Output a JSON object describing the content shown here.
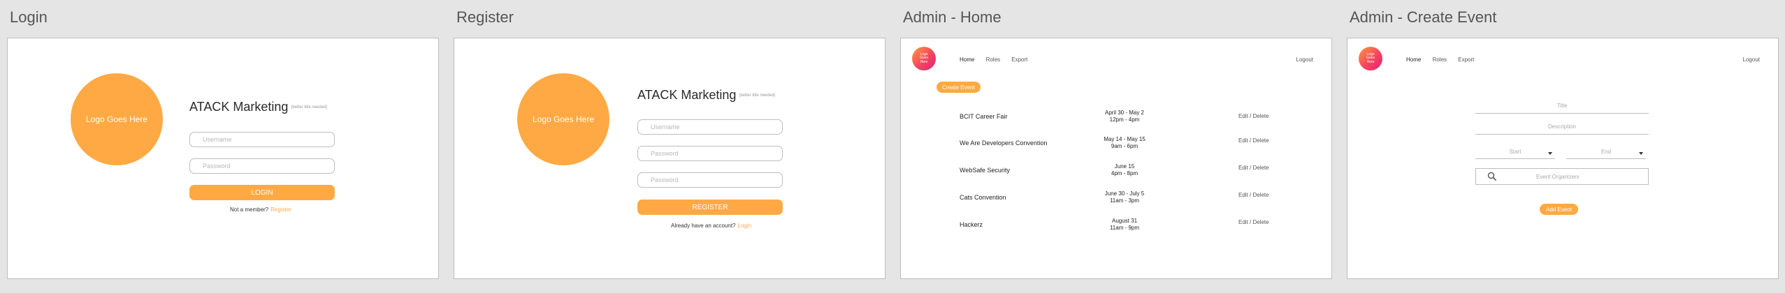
{
  "boards": {
    "login": {
      "title": "Login"
    },
    "register": {
      "title": "Register"
    },
    "admin_home": {
      "title": "Admin - Home"
    },
    "admin_create": {
      "title": "Admin - Create Event"
    }
  },
  "login": {
    "logo": "Logo Goes Here",
    "brand": "ATACK Marketing",
    "brand_sub": "(better title needed)",
    "username_placeholder": "Username",
    "password_placeholder": "Password",
    "submit": "LOGIN",
    "footer_text": "Not a member?",
    "footer_link": "Register"
  },
  "register": {
    "logo": "Logo Goes Here",
    "brand": "ATACK Marketing",
    "brand_sub": "(better title needed)",
    "username_placeholder": "Username",
    "password_placeholder": "Password",
    "confirm_placeholder": "Password",
    "submit": "REGISTER",
    "footer_text": "Already have an account?",
    "footer_link": "Login"
  },
  "admin": {
    "logo": "Logo Goes Here",
    "nav": {
      "home": "Home",
      "roles": "Roles",
      "export": "Export"
    },
    "logout": "Logout"
  },
  "admin_home": {
    "create_button": "Create Event",
    "events": [
      {
        "name": "BCIT Career Fair",
        "date": "April 30 - May 2",
        "time": "12pm - 4pm",
        "actions": "Edit / Delete"
      },
      {
        "name": "We Are Developers Convention",
        "date": "May 14 - May 15",
        "time": "9am - 6pm",
        "actions": "Edit / Delete"
      },
      {
        "name": "WebSafe Security",
        "date": "June 15",
        "time": "4pm - 8pm",
        "actions": "Edit / Delete"
      },
      {
        "name": "Cats Convention",
        "date": "June 30 - July 5",
        "time": "11am - 3pm",
        "actions": "Edit / Delete"
      },
      {
        "name": "Hackerz",
        "date": "August 31",
        "time": "11am - 9pm",
        "actions": "Edit / Delete"
      }
    ]
  },
  "admin_create": {
    "title_placeholder": "Title",
    "description_placeholder": "Description",
    "start_label": "Start",
    "end_label": "End",
    "organizers_placeholder": "Event Organizers",
    "add_button": "Add Event"
  },
  "colors": {
    "accent": "#ffa944",
    "background": "#e5e5e5"
  },
  "icons": [
    "search-icon",
    "chevron-down-icon"
  ]
}
